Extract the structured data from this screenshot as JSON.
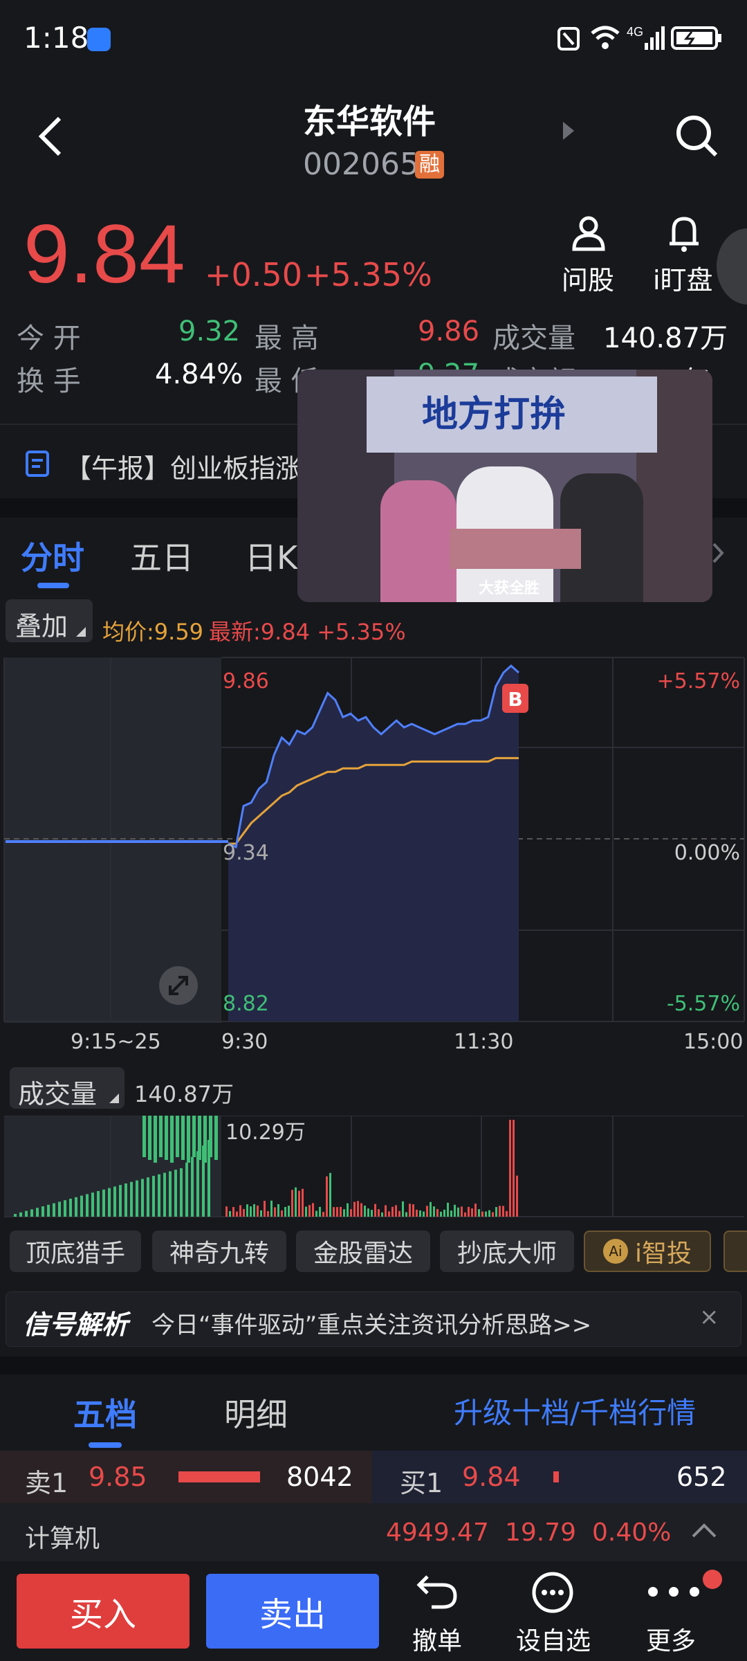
{
  "status": {
    "time": "1:18",
    "right_icons": [
      "nfc-icon",
      "wifi-icon",
      "4g-signal-icon",
      "battery-icon"
    ]
  },
  "header": {
    "title": "东华软件",
    "code": "002065",
    "rong_badge": "融"
  },
  "quote": {
    "price": "9.84",
    "change": "+0.50",
    "change_pct": "+5.35%"
  },
  "actions": {
    "ask": "问股",
    "watch": "i盯盘"
  },
  "stats": [
    {
      "label": "今 开",
      "value": "9.32"
    },
    {
      "label": "最 高",
      "value": "9.86"
    },
    {
      "label": "成交量",
      "value": "140.87万"
    },
    {
      "label": "换 手",
      "value": "4.84%"
    },
    {
      "label": "最 低",
      "value": "9.27"
    },
    {
      "label": "成交额",
      "value": "13.51亿"
    }
  ],
  "news": {
    "text": "【午报】创业板指涨"
  },
  "chart_tabs": [
    "分时",
    "五日",
    "日K"
  ],
  "overlay": {
    "label": "叠加",
    "avg": "均价:9.59",
    "latest": "最新:9.84 +5.35%"
  },
  "chart_labels": {
    "top": "9.86",
    "mid": "9.34",
    "bottom": "8.82",
    "top_pct": "+5.57%",
    "mid_pct": "0.00%",
    "bottom_pct": "-5.57%",
    "b_marker": "B"
  },
  "time_axis": [
    "9:15~25",
    "9:30",
    "11:30",
    "15:00"
  ],
  "volume": {
    "label": "成交量",
    "value": "140.87万",
    "max": "10.29万"
  },
  "tools": [
    "顶底猎手",
    "神奇九转",
    "金股雷达",
    "抄底大师",
    "i智投"
  ],
  "signal": {
    "logo": "信号解析",
    "text": "今日“事件驱动”重点关注资讯分析思路>>",
    "close": "×"
  },
  "book_tabs": {
    "five": "五档",
    "detail": "明细",
    "upgrade": "升级十档/千档行情"
  },
  "book": {
    "sell_label": "卖1",
    "sell_price": "9.85",
    "sell_vol": "8042",
    "buy_label": "买1",
    "buy_price": "9.84",
    "buy_vol": "652"
  },
  "sector": {
    "name": "计算机",
    "index": "4949.47",
    "change": "19.79",
    "pct": "0.40%"
  },
  "video": {
    "headline": "地方打拚",
    "caption": "大获全胜"
  },
  "bottom": {
    "buy": "买入",
    "sell": "卖出",
    "cancel": "撤单",
    "fav": "设自选",
    "more": "更多"
  },
  "chart_data": {
    "type": "line",
    "title": "",
    "xlabel": "",
    "ylabel": "",
    "ylim": [
      8.82,
      9.86
    ],
    "x_ticks": [
      "9:15~25",
      "9:30",
      "11:30",
      "15:00"
    ],
    "series": [
      {
        "name": "最新",
        "values": [
          9.34,
          9.33,
          9.45,
          9.46,
          9.5,
          9.52,
          9.6,
          9.65,
          9.63,
          9.67,
          9.66,
          9.68,
          9.73,
          9.78,
          9.76,
          9.71,
          9.72,
          9.7,
          9.71,
          9.68,
          9.66,
          9.68,
          9.7,
          9.68,
          9.69,
          9.68,
          9.67,
          9.66,
          9.67,
          9.68,
          9.69,
          9.69,
          9.7,
          9.7,
          9.71,
          9.8,
          9.84,
          9.86,
          9.84
        ]
      },
      {
        "name": "均价",
        "values": [
          9.34,
          9.34,
          9.37,
          9.4,
          9.42,
          9.44,
          9.46,
          9.48,
          9.49,
          9.51,
          9.52,
          9.53,
          9.54,
          9.55,
          9.55,
          9.56,
          9.56,
          9.56,
          9.57,
          9.57,
          9.57,
          9.57,
          9.57,
          9.57,
          9.58,
          9.58,
          9.58,
          9.58,
          9.58,
          9.58,
          9.58,
          9.58,
          9.58,
          9.58,
          9.58,
          9.59,
          9.59,
          9.59,
          9.59
        ]
      }
    ]
  }
}
